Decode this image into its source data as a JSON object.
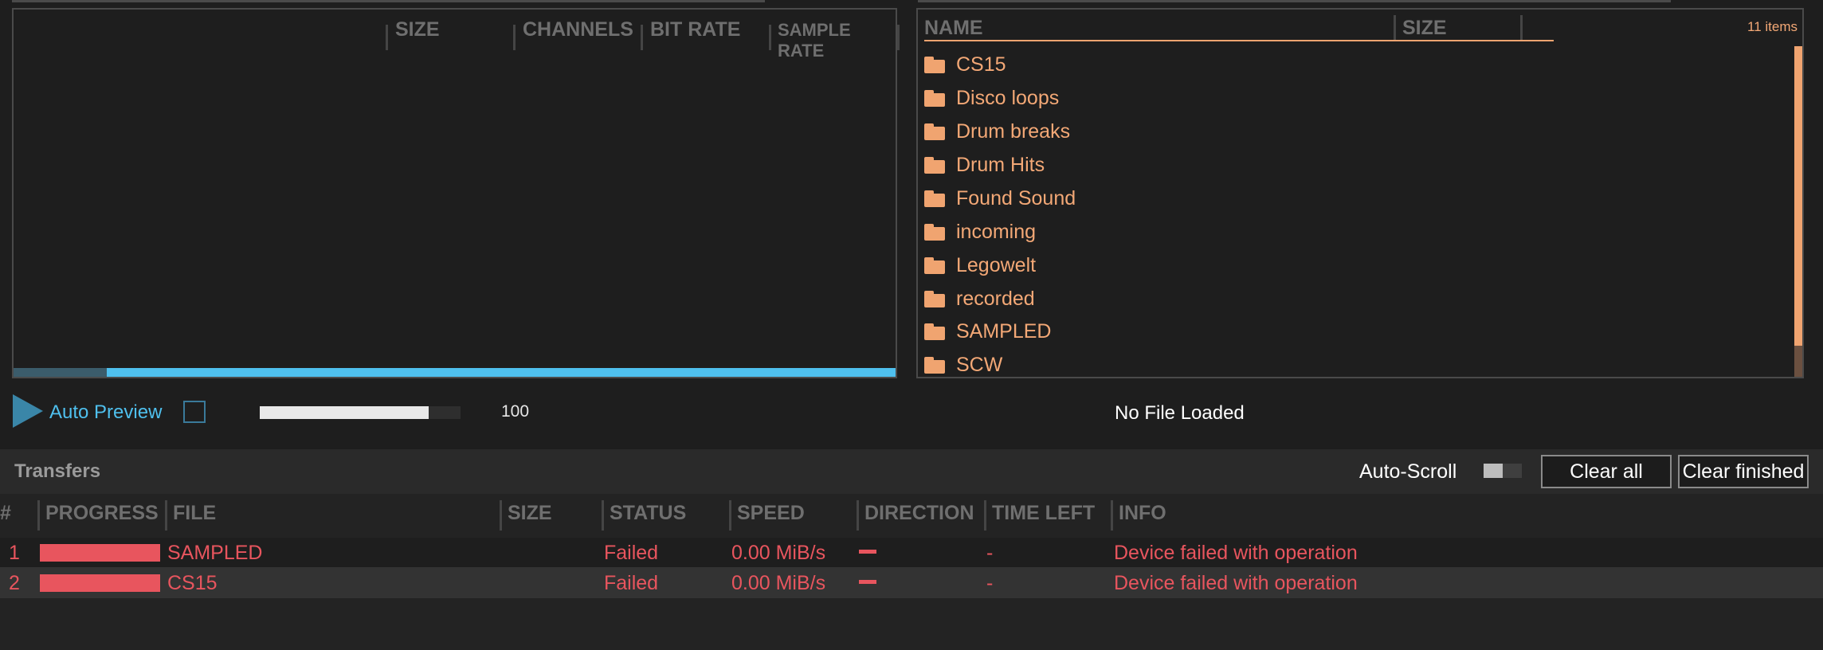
{
  "left_panel": {
    "columns": [
      "SIZE",
      "CHANNELS",
      "BIT RATE",
      "SAMPLE RATE"
    ],
    "scroll_position": 0.1
  },
  "right_panel": {
    "columns": [
      "NAME",
      "SIZE"
    ],
    "item_count": "11 items",
    "folders": [
      "CS15",
      "Disco loops",
      "Drum breaks",
      "Drum Hits",
      "Found Sound",
      "incoming",
      "Legowelt",
      "recorded",
      "SAMPLED",
      "SCW"
    ]
  },
  "preview": {
    "label": "Auto Preview",
    "checked": false,
    "volume_value": "100",
    "volume_fraction": 0.84,
    "status": "No File Loaded"
  },
  "transfers": {
    "title": "Transfers",
    "auto_scroll_label": "Auto-Scroll",
    "clear_all_label": "Clear all",
    "clear_finished_label": "Clear finished",
    "columns": [
      "#",
      "PROGRESS",
      "FILE",
      "SIZE",
      "STATUS",
      "SPEED",
      "DIRECTION",
      "TIME LEFT",
      "INFO"
    ],
    "rows": [
      {
        "num": "1",
        "progress": 1.0,
        "file": "SAMPLED",
        "size": "",
        "status": "Failed",
        "speed": "0.00 MiB/s",
        "time_left": "-",
        "info": "Device failed with operation"
      },
      {
        "num": "2",
        "progress": 1.0,
        "file": "CS15",
        "size": "",
        "status": "Failed",
        "speed": "0.00 MiB/s",
        "time_left": "-",
        "info": "Device failed with operation"
      }
    ]
  },
  "colors": {
    "accent_blue": "#4fc0ee",
    "folder_orange": "#f0a470",
    "error_red": "#e8555e"
  }
}
